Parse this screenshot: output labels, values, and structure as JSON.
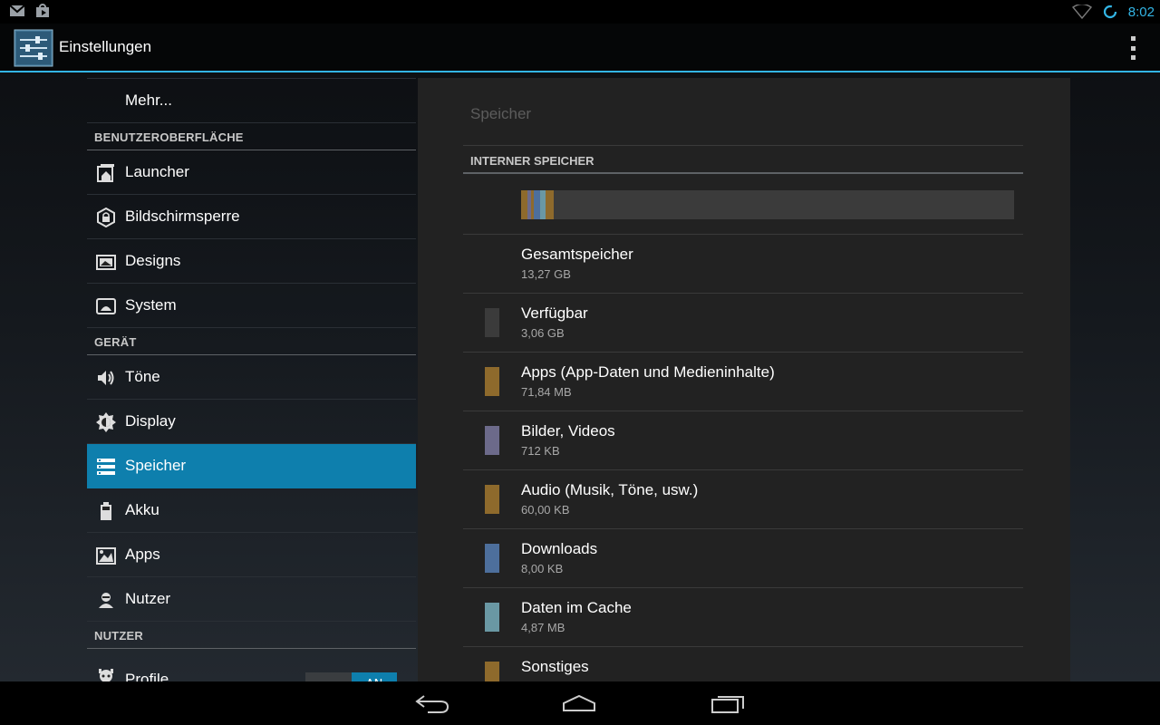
{
  "status_bar": {
    "left_icons": [
      "gmail-icon",
      "play-store-update-icon"
    ],
    "wifi_icon": "wifi-icon",
    "sync_icon": "sync-icon",
    "time": "8:02",
    "accent_color": "#33b5e5"
  },
  "action_bar": {
    "app_icon": "settings-app-icon",
    "title": "Einstellungen",
    "overflow_icon": "overflow-menu-icon"
  },
  "sidebar": {
    "top_item": {
      "label": "Mehr..."
    },
    "sections": [
      {
        "header": "BENUTZEROBERFLÄCHE",
        "items": [
          {
            "label": "Launcher",
            "icon": "launcher-icon"
          },
          {
            "label": "Bildschirmsperre",
            "icon": "lock-icon"
          },
          {
            "label": "Designs",
            "icon": "designs-icon"
          },
          {
            "label": "System",
            "icon": "system-icon"
          }
        ]
      },
      {
        "header": "GERÄT",
        "items": [
          {
            "label": "Töne",
            "icon": "speaker-icon"
          },
          {
            "label": "Display",
            "icon": "brightness-icon"
          },
          {
            "label": "Speicher",
            "icon": "storage-icon",
            "selected": true
          },
          {
            "label": "Akku",
            "icon": "battery-icon"
          },
          {
            "label": "Apps",
            "icon": "apps-icon"
          },
          {
            "label": "Nutzer",
            "icon": "user-icon"
          }
        ]
      },
      {
        "header": "NUTZER",
        "items": [
          {
            "label": "Profile",
            "icon": "profile-icon",
            "toggle": "AN"
          }
        ]
      }
    ],
    "selected_color": "#0e7fad"
  },
  "storage": {
    "title": "Speicher",
    "section_header": "INTERNER SPEICHER",
    "usage_bar": [
      {
        "name": "Apps",
        "fraction": 0.012,
        "color": "#8e6a2c"
      },
      {
        "name": "Bilder, Videos",
        "fraction": 0.008,
        "color": "#6c6a8a"
      },
      {
        "name": "Audio",
        "fraction": 0.006,
        "color": "#8e6a2c"
      },
      {
        "name": "Downloads",
        "fraction": 0.012,
        "color": "#4d6f9c"
      },
      {
        "name": "Daten im Cache",
        "fraction": 0.011,
        "color": "#6a98a4"
      },
      {
        "name": "Sonstiges",
        "fraction": 0.018,
        "color": "#8e6a2c"
      }
    ],
    "rows": [
      {
        "title": "Gesamtspeicher",
        "value": "13,27 GB",
        "color": null
      },
      {
        "title": "Verfügbar",
        "value": "3,06 GB",
        "color": "#3b3b3b"
      },
      {
        "title": "Apps (App-Daten und Medieninhalte)",
        "value": "71,84 MB",
        "color": "#8e6a2c"
      },
      {
        "title": "Bilder, Videos",
        "value": "712 KB",
        "color": "#6c6a8a"
      },
      {
        "title": "Audio (Musik, Töne, usw.)",
        "value": "60,00 KB",
        "color": "#8e6a2c"
      },
      {
        "title": "Downloads",
        "value": "8,00 KB",
        "color": "#4d6f9c"
      },
      {
        "title": "Daten im Cache",
        "value": "4,87 MB",
        "color": "#6a98a4"
      },
      {
        "title": "Sonstiges",
        "value": "",
        "color": "#8e6a2c"
      }
    ]
  },
  "nav_bar": {
    "buttons": [
      "back-icon",
      "home-icon",
      "recents-icon"
    ]
  }
}
